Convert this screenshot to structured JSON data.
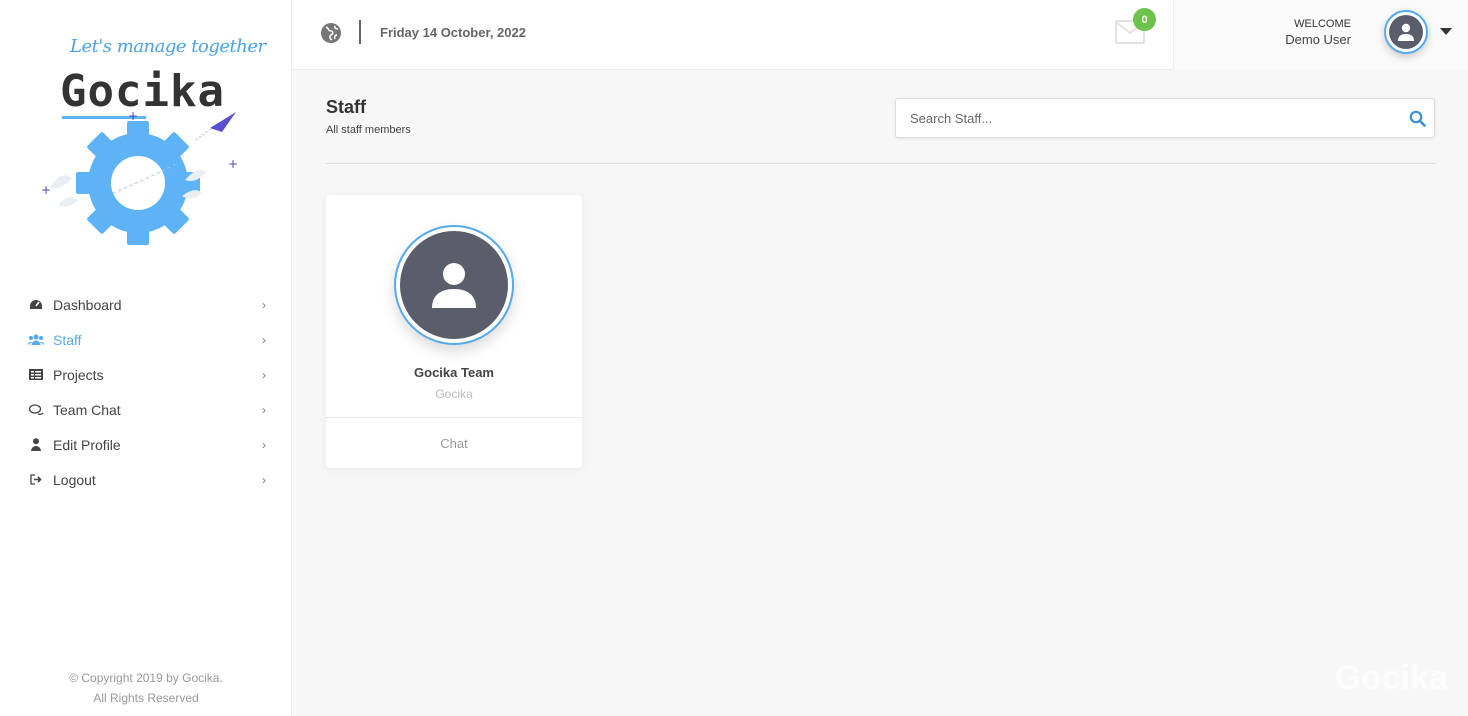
{
  "sidebar": {
    "tagline": "Let's manage together",
    "brand": "Gocika",
    "items": [
      {
        "label": "Dashboard",
        "icon": "dashboard-icon",
        "active": false
      },
      {
        "label": "Staff",
        "icon": "users-icon",
        "active": true
      },
      {
        "label": "Projects",
        "icon": "projects-icon",
        "active": false
      },
      {
        "label": "Team Chat",
        "icon": "chat-icon",
        "active": false
      },
      {
        "label": "Edit Profile",
        "icon": "user-icon",
        "active": false
      },
      {
        "label": "Logout",
        "icon": "logout-icon",
        "active": false
      }
    ],
    "copyright_line1": "© Copyright 2019 by Gocika.",
    "copyright_line2": "All Rights Reserved"
  },
  "header": {
    "date": "Friday 14 October, 2022",
    "mail_count": "0",
    "welcome_label": "WELCOME",
    "user_name": "Demo User"
  },
  "main": {
    "title": "Staff",
    "subtitle": "All staff members",
    "search_placeholder": "Search Staff...",
    "cards": [
      {
        "name": "Gocika Team",
        "org": "Gocika",
        "action": "Chat"
      }
    ]
  },
  "watermark": "Gocika",
  "colors": {
    "accent": "#55a9ec",
    "badge": "#6cc24a",
    "avatar_bg": "#5a5e6a",
    "logo_gear": "#5db3f5"
  }
}
